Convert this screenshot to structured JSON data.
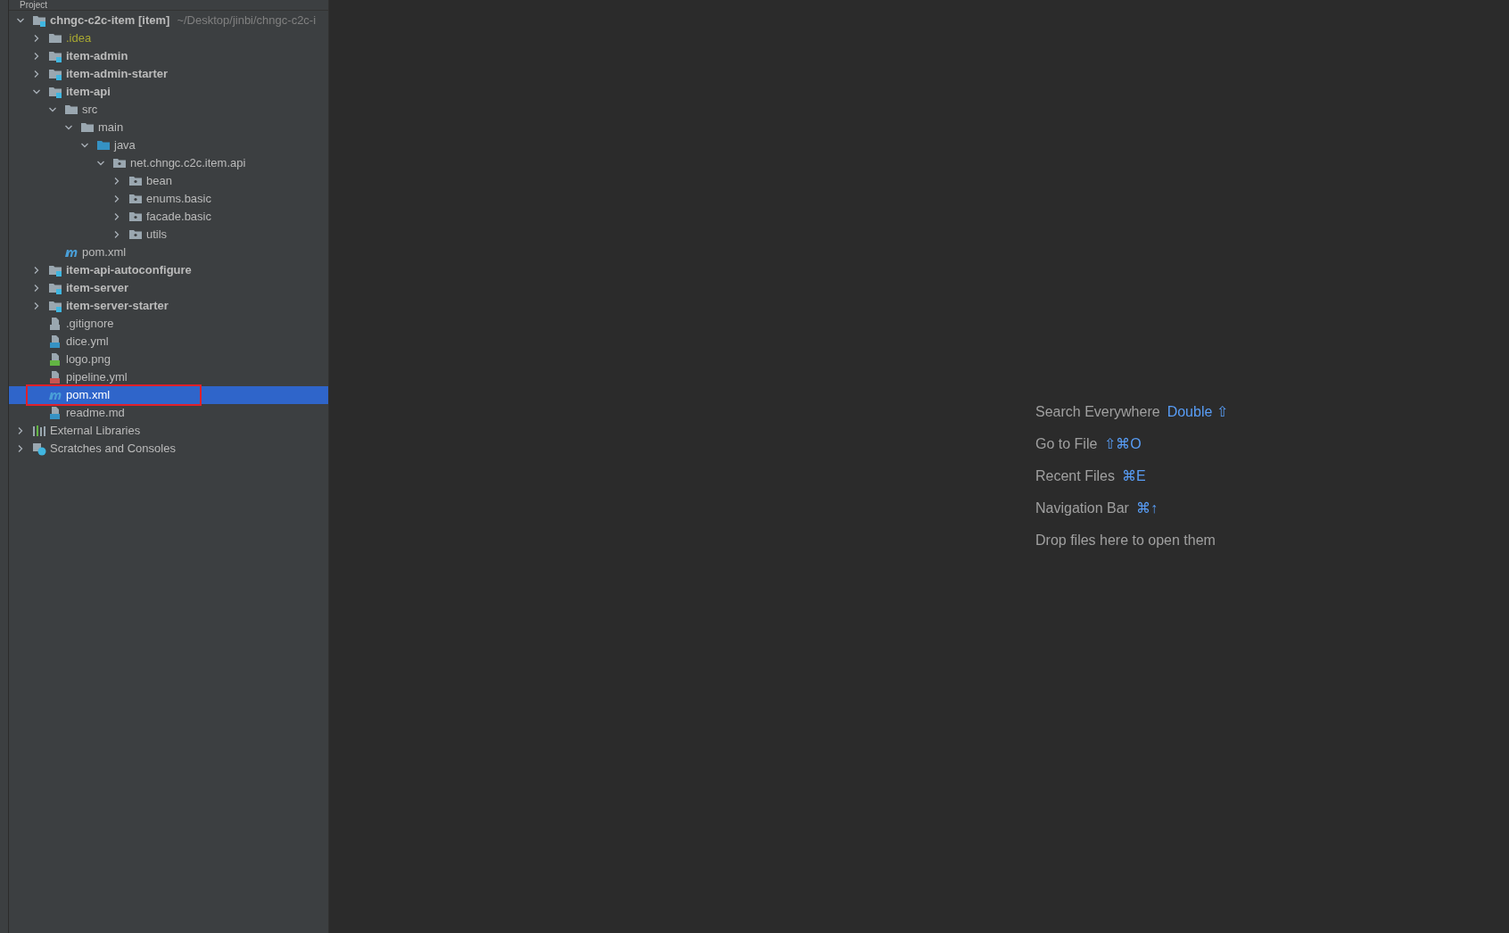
{
  "panel": {
    "title": "Project"
  },
  "tree": [
    {
      "label": "chngc-c2c-item **[item]**",
      "path": "~/Desktop/jinbi/chngc-c2c-i",
      "kind": "module",
      "expanded": true,
      "selected": false,
      "highlighted": false,
      "children": [
        {
          "label": ".idea",
          "kind": "ignored-folder",
          "expanded": false,
          "selected": false,
          "highlighted": false
        },
        {
          "label": "item-admin",
          "kind": "module",
          "expanded": false,
          "selected": false,
          "highlighted": false
        },
        {
          "label": "item-admin-starter",
          "kind": "module",
          "expanded": false,
          "selected": false,
          "highlighted": false
        },
        {
          "label": "item-api",
          "kind": "module",
          "expanded": true,
          "selected": false,
          "highlighted": false,
          "children": [
            {
              "label": "src",
              "kind": "folder",
              "expanded": true,
              "selected": false,
              "highlighted": false,
              "children": [
                {
                  "label": "main",
                  "kind": "folder",
                  "expanded": true,
                  "selected": false,
                  "highlighted": false,
                  "children": [
                    {
                      "label": "java",
                      "kind": "source-folder",
                      "expanded": true,
                      "selected": false,
                      "highlighted": false,
                      "children": [
                        {
                          "label": "net.chngc.c2c.item.api",
                          "kind": "package",
                          "expanded": true,
                          "selected": false,
                          "highlighted": false,
                          "children": [
                            {
                              "label": "bean",
                              "kind": "package",
                              "expanded": false,
                              "selected": false,
                              "highlighted": false
                            },
                            {
                              "label": "enums.basic",
                              "kind": "package",
                              "expanded": false,
                              "selected": false,
                              "highlighted": false
                            },
                            {
                              "label": "facade.basic",
                              "kind": "package",
                              "expanded": false,
                              "selected": false,
                              "highlighted": false
                            },
                            {
                              "label": "utils",
                              "kind": "package",
                              "expanded": false,
                              "selected": false,
                              "highlighted": false
                            }
                          ]
                        }
                      ]
                    }
                  ]
                }
              ]
            },
            {
              "label": "pom.xml",
              "kind": "maven",
              "selected": false,
              "highlighted": false
            }
          ]
        },
        {
          "label": "item-api-autoconfigure",
          "kind": "module",
          "expanded": false,
          "selected": false,
          "highlighted": false
        },
        {
          "label": "item-server",
          "kind": "module",
          "expanded": false,
          "selected": false,
          "highlighted": false
        },
        {
          "label": "item-server-starter",
          "kind": "module",
          "expanded": false,
          "selected": false,
          "highlighted": false
        },
        {
          "label": ".gitignore",
          "kind": "ignore-file",
          "selected": false,
          "highlighted": false
        },
        {
          "label": "dice.yml",
          "kind": "dice-file",
          "selected": false,
          "highlighted": false
        },
        {
          "label": "logo.png",
          "kind": "image-file",
          "selected": false,
          "highlighted": false
        },
        {
          "label": "pipeline.yml",
          "kind": "yml-file",
          "selected": false,
          "highlighted": false
        },
        {
          "label": "pom.xml",
          "kind": "maven",
          "selected": true,
          "highlighted": true
        },
        {
          "label": "readme.md",
          "kind": "md-file",
          "selected": false,
          "highlighted": false
        }
      ]
    },
    {
      "label": "External Libraries",
      "kind": "libraries",
      "expanded": false,
      "selected": false,
      "highlighted": false
    },
    {
      "label": "Scratches and Consoles",
      "kind": "scratches",
      "expanded": false,
      "selected": false,
      "highlighted": false
    }
  ],
  "hints": [
    {
      "label": "Search Everywhere",
      "shortcut": "Double ⇧"
    },
    {
      "label": "Go to File",
      "shortcut": "⇧⌘O"
    },
    {
      "label": "Recent Files",
      "shortcut": "⌘E"
    },
    {
      "label": "Navigation Bar",
      "shortcut": "⌘↑"
    },
    {
      "label": "Drop files here to open them"
    }
  ]
}
